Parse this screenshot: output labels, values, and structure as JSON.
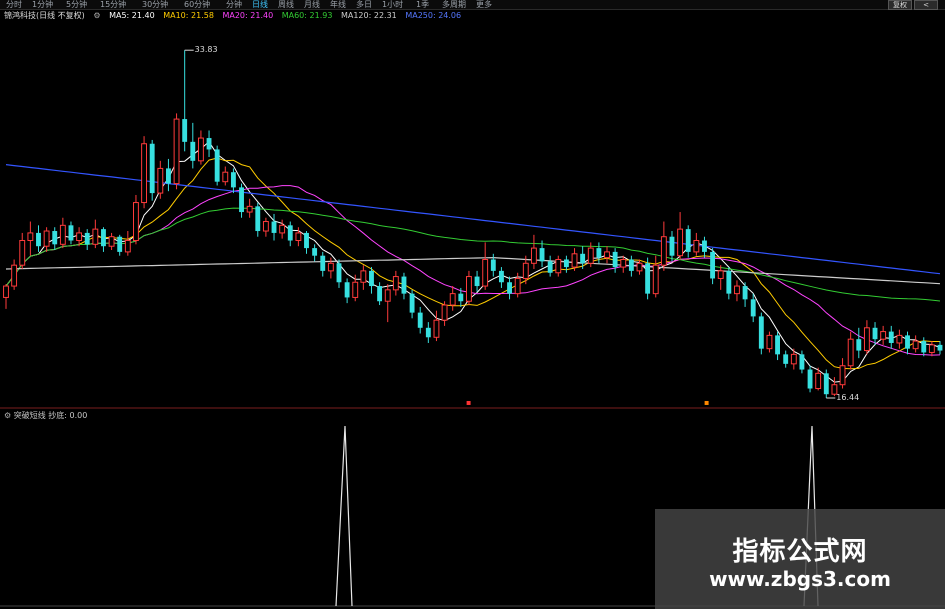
{
  "toolbar": {
    "tabs": [
      "分时",
      "1分钟",
      "5分钟",
      "15分钟",
      "30分钟",
      "60分钟",
      "分钟",
      "日线",
      "周线",
      "月线",
      "年线",
      "多日",
      "1小时",
      "1季",
      "多周期",
      "更多"
    ],
    "active_tab": "日线",
    "buttons": [
      "复权",
      "<"
    ]
  },
  "legend": {
    "title": "锦鸿科技(日线 不复权)",
    "ma5": "MA5: 21.40",
    "ma10": "MA10: 21.58",
    "ma20": "MA20: 21.40",
    "ma60": "MA60: 21.93",
    "ma120": "MA120: 22.31",
    "ma250": "MA250: 24.06",
    "colors": {
      "ma5": "#ffffff",
      "ma10": "#ffcc00",
      "ma20": "#ff44ff",
      "ma60": "#33cc33",
      "ma120": "#cccccc",
      "ma250": "#3355ff"
    }
  },
  "annotations": {
    "high_price": "33.83",
    "low_price": "16.44"
  },
  "sub_panel": {
    "indicator": "突破短线 抄底: 0.00"
  },
  "watermark": {
    "title": "指标公式网",
    "url": "www.zbgs3.com"
  },
  "chart_data": {
    "type": "candlestick",
    "title": "",
    "price_range": [
      15.5,
      35
    ],
    "candles": [
      [
        20.8,
        21.4,
        20.2,
        21.5
      ],
      [
        21.4,
        22.5,
        21.2,
        22.8
      ],
      [
        22.5,
        23.8,
        22.3,
        24.2
      ],
      [
        23.8,
        24.2,
        23.0,
        24.8
      ],
      [
        24.2,
        23.5,
        23.2,
        24.6
      ],
      [
        23.5,
        24.3,
        23.2,
        24.5
      ],
      [
        24.3,
        23.6,
        23.3,
        24.5
      ],
      [
        23.6,
        24.6,
        23.4,
        25.0
      ],
      [
        24.6,
        23.8,
        23.6,
        24.8
      ],
      [
        23.8,
        24.2,
        23.5,
        24.5
      ],
      [
        24.2,
        23.6,
        23.3,
        24.4
      ],
      [
        23.6,
        24.4,
        23.4,
        24.9
      ],
      [
        24.4,
        23.5,
        23.2,
        24.5
      ],
      [
        23.5,
        24.0,
        23.3,
        24.2
      ],
      [
        24.0,
        23.2,
        23.0,
        24.1
      ],
      [
        23.2,
        23.8,
        23.0,
        24.3
      ],
      [
        23.8,
        25.8,
        23.6,
        26.2
      ],
      [
        25.8,
        28.9,
        25.5,
        29.3
      ],
      [
        28.9,
        26.3,
        25.9,
        29.1
      ],
      [
        26.3,
        27.6,
        26.0,
        28.0
      ],
      [
        27.6,
        26.8,
        26.4,
        28.1
      ],
      [
        26.8,
        30.2,
        26.5,
        30.5
      ],
      [
        30.2,
        29.0,
        28.5,
        33.83
      ],
      [
        29.0,
        28.0,
        27.6,
        30.0
      ],
      [
        28.0,
        29.2,
        27.8,
        29.6
      ],
      [
        29.2,
        28.6,
        28.2,
        29.6
      ],
      [
        28.6,
        26.9,
        26.7,
        28.8
      ],
      [
        26.9,
        27.4,
        26.7,
        27.7
      ],
      [
        27.4,
        26.6,
        26.3,
        27.6
      ],
      [
        26.6,
        25.3,
        25.0,
        26.8
      ],
      [
        25.3,
        25.6,
        25.0,
        26.0
      ],
      [
        25.6,
        24.3,
        24.0,
        25.8
      ],
      [
        24.3,
        24.8,
        24.0,
        25.0
      ],
      [
        24.8,
        24.2,
        23.8,
        25.2
      ],
      [
        24.2,
        24.6,
        23.9,
        24.9
      ],
      [
        24.6,
        23.8,
        23.5,
        24.8
      ],
      [
        23.8,
        24.2,
        23.5,
        24.5
      ],
      [
        24.2,
        23.4,
        23.1,
        24.3
      ],
      [
        23.4,
        23.0,
        22.7,
        23.6
      ],
      [
        23.0,
        22.2,
        21.9,
        23.2
      ],
      [
        22.2,
        22.6,
        21.8,
        22.9
      ],
      [
        22.6,
        21.6,
        21.3,
        22.8
      ],
      [
        21.6,
        20.8,
        20.5,
        21.8
      ],
      [
        20.8,
        21.6,
        20.6,
        22.0
      ],
      [
        21.6,
        22.2,
        21.2,
        22.5
      ],
      [
        22.2,
        21.4,
        21.0,
        22.4
      ],
      [
        21.4,
        20.6,
        20.4,
        21.6
      ],
      [
        20.6,
        21.2,
        19.5,
        21.5
      ],
      [
        21.2,
        21.9,
        20.9,
        22.2
      ],
      [
        21.9,
        21.0,
        20.7,
        22.1
      ],
      [
        21.0,
        20.0,
        19.7,
        21.2
      ],
      [
        20.0,
        19.2,
        18.9,
        20.3
      ],
      [
        19.2,
        18.7,
        18.4,
        19.5
      ],
      [
        18.7,
        19.6,
        18.5,
        20.1
      ],
      [
        19.6,
        20.4,
        19.3,
        20.6
      ],
      [
        20.4,
        21.0,
        20.1,
        21.4
      ],
      [
        21.0,
        20.6,
        20.3,
        21.3
      ],
      [
        20.6,
        21.9,
        20.4,
        22.2
      ],
      [
        21.9,
        21.4,
        21.1,
        22.2
      ],
      [
        21.4,
        22.8,
        21.2,
        23.7
      ],
      [
        22.8,
        22.2,
        21.9,
        23.1
      ],
      [
        22.2,
        21.6,
        21.3,
        22.4
      ],
      [
        21.6,
        21.0,
        20.7,
        21.9
      ],
      [
        21.0,
        21.8,
        20.8,
        22.1
      ],
      [
        21.8,
        22.6,
        21.5,
        23.0
      ],
      [
        22.6,
        23.4,
        22.3,
        24.1
      ],
      [
        23.4,
        22.7,
        22.4,
        23.8
      ],
      [
        22.7,
        22.1,
        21.9,
        23.0
      ],
      [
        22.1,
        22.8,
        21.9,
        23.0
      ],
      [
        22.8,
        22.4,
        22.1,
        23.0
      ],
      [
        22.4,
        23.1,
        22.2,
        23.4
      ],
      [
        23.1,
        22.6,
        22.3,
        23.5
      ],
      [
        22.6,
        23.4,
        22.4,
        23.7
      ],
      [
        23.4,
        22.9,
        22.6,
        23.7
      ],
      [
        22.9,
        23.2,
        22.6,
        23.5
      ],
      [
        23.2,
        22.4,
        22.1,
        23.4
      ],
      [
        22.4,
        22.8,
        22.1,
        23.0
      ],
      [
        22.8,
        22.2,
        21.9,
        23.0
      ],
      [
        22.2,
        22.6,
        22.0,
        22.8
      ],
      [
        22.6,
        21.0,
        20.7,
        22.9
      ],
      [
        21.0,
        22.5,
        20.8,
        23.0
      ],
      [
        22.5,
        24.0,
        22.2,
        24.8
      ],
      [
        24.0,
        23.0,
        22.7,
        24.3
      ],
      [
        23.0,
        24.4,
        22.8,
        25.3
      ],
      [
        24.4,
        23.2,
        22.9,
        24.6
      ],
      [
        23.2,
        23.8,
        23.0,
        24.2
      ],
      [
        23.8,
        23.2,
        22.9,
        24.0
      ],
      [
        23.2,
        21.8,
        21.5,
        23.4
      ],
      [
        21.8,
        22.2,
        21.2,
        22.5
      ],
      [
        22.2,
        21.0,
        20.7,
        22.4
      ],
      [
        21.0,
        21.4,
        20.6,
        21.7
      ],
      [
        21.4,
        20.7,
        20.3,
        21.6
      ],
      [
        20.7,
        19.8,
        19.5,
        21.0
      ],
      [
        19.8,
        18.1,
        17.8,
        20.0
      ],
      [
        18.1,
        18.8,
        17.9,
        19.0
      ],
      [
        18.8,
        17.8,
        17.5,
        19.0
      ],
      [
        17.8,
        17.3,
        17.1,
        18.0
      ],
      [
        17.3,
        17.8,
        17.0,
        18.1
      ],
      [
        17.8,
        17.0,
        16.8,
        18.0
      ],
      [
        17.0,
        16.0,
        15.8,
        17.2
      ],
      [
        16.0,
        16.8,
        15.9,
        17.1
      ],
      [
        16.8,
        15.7,
        15.5,
        17.0
      ],
      [
        15.7,
        16.2,
        15.6,
        16.6
      ],
      [
        16.2,
        17.2,
        16.0,
        17.6
      ],
      [
        17.2,
        18.6,
        17.0,
        19.0
      ],
      [
        18.6,
        18.0,
        17.6,
        19.2
      ],
      [
        18.0,
        19.2,
        17.8,
        19.6
      ],
      [
        19.2,
        18.6,
        18.3,
        19.5
      ],
      [
        18.6,
        19.0,
        18.3,
        19.3
      ],
      [
        19.0,
        18.4,
        18.1,
        19.3
      ],
      [
        18.4,
        18.8,
        18.1,
        19.1
      ],
      [
        18.8,
        18.1,
        17.8,
        19.0
      ],
      [
        18.1,
        18.5,
        17.9,
        18.8
      ],
      [
        18.5,
        17.9,
        17.7,
        18.7
      ],
      [
        17.9,
        18.3,
        17.7,
        18.5
      ],
      [
        18.3,
        18.0,
        17.8,
        18.5
      ]
    ]
  }
}
